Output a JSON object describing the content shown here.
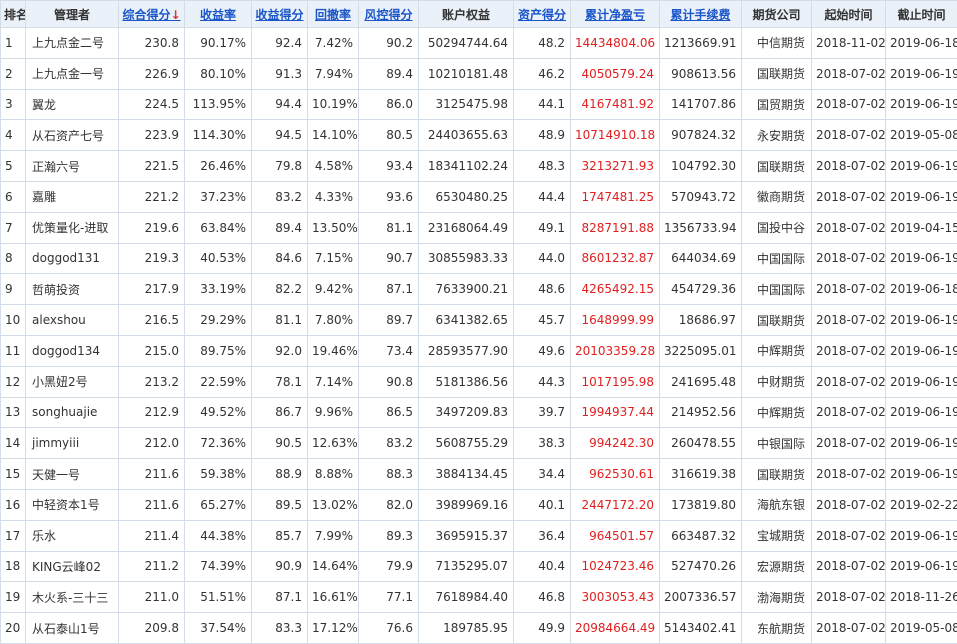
{
  "headers": [
    {
      "key": "rank",
      "label": "排名",
      "sortable": false
    },
    {
      "key": "manager",
      "label": "管理者",
      "sortable": false
    },
    {
      "key": "total_score",
      "label": "综合得分",
      "sortable": true,
      "active": true,
      "arrow": "↓"
    },
    {
      "key": "return_rate",
      "label": "收益率",
      "sortable": true
    },
    {
      "key": "return_score",
      "label": "收益得分",
      "sortable": true
    },
    {
      "key": "drawdown",
      "label": "回撤率",
      "sortable": true
    },
    {
      "key": "risk_score",
      "label": "风控得分",
      "sortable": true
    },
    {
      "key": "equity",
      "label": "账户权益",
      "sortable": false
    },
    {
      "key": "asset_score",
      "label": "资产得分",
      "sortable": true
    },
    {
      "key": "cum_profit",
      "label": "累计净盈亏",
      "sortable": true
    },
    {
      "key": "cum_fee",
      "label": "累计手续费",
      "sortable": true
    },
    {
      "key": "company",
      "label": "期货公司",
      "sortable": false
    },
    {
      "key": "start",
      "label": "起始时间",
      "sortable": false
    },
    {
      "key": "end",
      "label": "截止时间",
      "sortable": false
    }
  ],
  "rows": [
    [
      "1",
      "上九点金二号",
      "230.8",
      "90.17%",
      "92.4",
      "7.42%",
      "90.2",
      "50294744.64",
      "48.2",
      "14434804.06",
      "1213669.91",
      "中信期货",
      "2018-11-02",
      "2019-06-18"
    ],
    [
      "2",
      "上九点金一号",
      "226.9",
      "80.10%",
      "91.3",
      "7.94%",
      "89.4",
      "10210181.48",
      "46.2",
      "4050579.24",
      "908613.56",
      "国联期货",
      "2018-07-02",
      "2019-06-19"
    ],
    [
      "3",
      "翼龙",
      "224.5",
      "113.95%",
      "94.4",
      "10.19%",
      "86.0",
      "3125475.98",
      "44.1",
      "4167481.92",
      "141707.86",
      "国贸期货",
      "2018-07-02",
      "2019-06-19"
    ],
    [
      "4",
      "从石资产七号",
      "223.9",
      "114.30%",
      "94.5",
      "14.10%",
      "80.5",
      "24403655.63",
      "48.9",
      "10714910.18",
      "907824.32",
      "永安期货",
      "2018-07-02",
      "2019-05-08"
    ],
    [
      "5",
      "正瀚六号",
      "221.5",
      "26.46%",
      "79.8",
      "4.58%",
      "93.4",
      "18341102.24",
      "48.3",
      "3213271.93",
      "104792.30",
      "国联期货",
      "2018-07-02",
      "2019-06-19"
    ],
    [
      "6",
      "嘉雕",
      "221.2",
      "37.23%",
      "83.2",
      "4.33%",
      "93.6",
      "6530480.25",
      "44.4",
      "1747481.25",
      "570943.72",
      "徽商期货",
      "2018-07-02",
      "2019-06-19"
    ],
    [
      "7",
      "优策量化-进取",
      "219.6",
      "63.84%",
      "89.4",
      "13.50%",
      "81.1",
      "23168064.49",
      "49.1",
      "8287191.88",
      "1356733.94",
      "国投中谷",
      "2018-07-02",
      "2019-04-15"
    ],
    [
      "8",
      "doggod131",
      "219.3",
      "40.53%",
      "84.6",
      "7.15%",
      "90.7",
      "30855983.33",
      "44.0",
      "8601232.87",
      "644034.69",
      "中国国际",
      "2018-07-02",
      "2019-06-19"
    ],
    [
      "9",
      "哲萌投资",
      "217.9",
      "33.19%",
      "82.2",
      "9.42%",
      "87.1",
      "7633900.21",
      "48.6",
      "4265492.15",
      "454729.36",
      "中国国际",
      "2018-07-02",
      "2019-06-18"
    ],
    [
      "10",
      "alexshou",
      "216.5",
      "29.29%",
      "81.1",
      "7.80%",
      "89.7",
      "6341382.65",
      "45.7",
      "1648999.99",
      "18686.97",
      "国联期货",
      "2018-07-02",
      "2019-06-19"
    ],
    [
      "11",
      "doggod134",
      "215.0",
      "89.75%",
      "92.0",
      "19.46%",
      "73.4",
      "28593577.90",
      "49.6",
      "20103359.28",
      "3225095.01",
      "中辉期货",
      "2018-07-02",
      "2019-06-19"
    ],
    [
      "12",
      "小黑妞2号",
      "213.2",
      "22.59%",
      "78.1",
      "7.14%",
      "90.8",
      "5181386.56",
      "44.3",
      "1017195.98",
      "241695.48",
      "中财期货",
      "2018-07-02",
      "2019-06-19"
    ],
    [
      "13",
      "songhuajie",
      "212.9",
      "49.52%",
      "86.7",
      "9.96%",
      "86.5",
      "3497209.83",
      "39.7",
      "1994937.44",
      "214952.56",
      "中辉期货",
      "2018-07-02",
      "2019-06-19"
    ],
    [
      "14",
      "jimmyiii",
      "212.0",
      "72.36%",
      "90.5",
      "12.63%",
      "83.2",
      "5608755.29",
      "38.3",
      "994242.30",
      "260478.55",
      "中银国际",
      "2018-07-02",
      "2019-06-19"
    ],
    [
      "15",
      "天健一号",
      "211.6",
      "59.38%",
      "88.9",
      "8.88%",
      "88.3",
      "3884134.45",
      "34.4",
      "962530.61",
      "316619.38",
      "国联期货",
      "2018-07-02",
      "2019-06-19"
    ],
    [
      "16",
      "中轻资本1号",
      "211.6",
      "65.27%",
      "89.5",
      "13.02%",
      "82.0",
      "3989969.16",
      "40.1",
      "2447172.20",
      "173819.80",
      "海航东银",
      "2018-07-02",
      "2019-02-22"
    ],
    [
      "17",
      "乐水",
      "211.4",
      "44.38%",
      "85.7",
      "7.99%",
      "89.3",
      "3695915.37",
      "36.4",
      "964501.57",
      "663487.32",
      "宝城期货",
      "2018-07-02",
      "2019-06-19"
    ],
    [
      "18",
      "KING云峰02",
      "211.2",
      "74.39%",
      "90.9",
      "14.64%",
      "79.9",
      "7135295.07",
      "40.4",
      "1024723.46",
      "527470.26",
      "宏源期货",
      "2018-07-02",
      "2019-06-19"
    ],
    [
      "19",
      "木火系-三十三",
      "211.0",
      "51.51%",
      "87.1",
      "16.61%",
      "77.1",
      "7618984.40",
      "46.8",
      "3003053.43",
      "2007336.57",
      "渤海期货",
      "2018-07-02",
      "2018-11-26"
    ],
    [
      "20",
      "从石泰山1号",
      "209.8",
      "37.54%",
      "83.3",
      "17.12%",
      "76.6",
      "189785.95",
      "49.9",
      "20984664.49",
      "5143402.41",
      "东航期货",
      "2018-07-02",
      "2019-05-08"
    ]
  ],
  "colors": {
    "header_bg": "#eaf1f8",
    "link": "#1a55c9",
    "profit": "#e02020",
    "border": "#d3dde8"
  }
}
